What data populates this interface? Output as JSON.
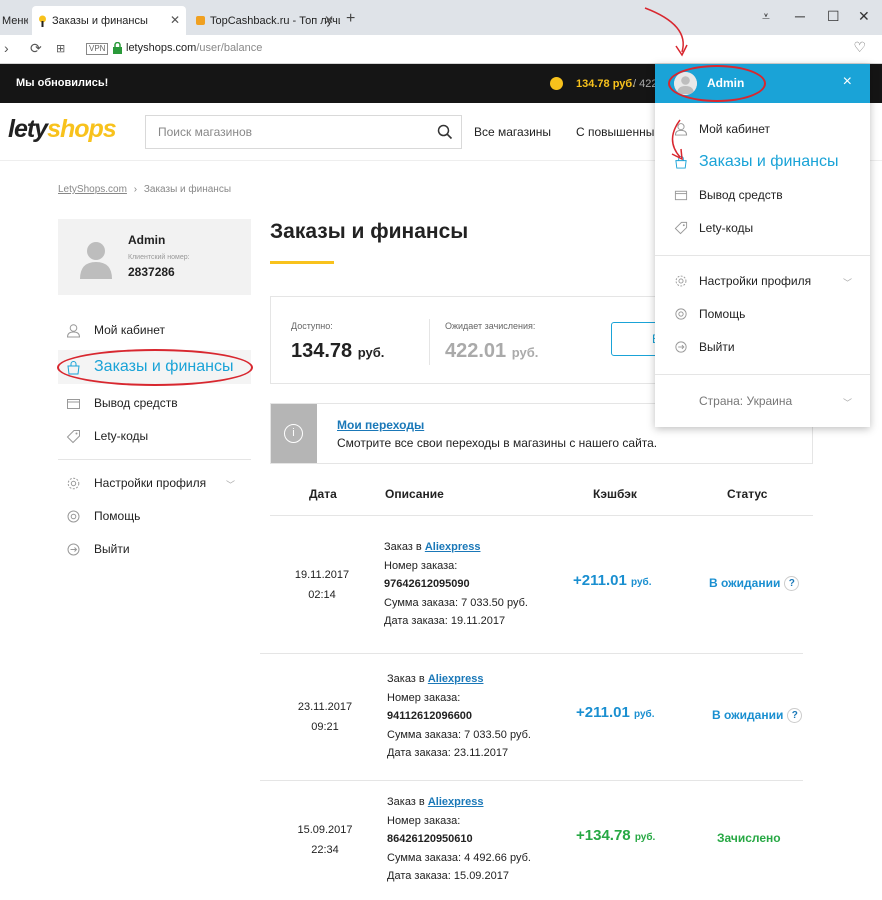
{
  "browser": {
    "tabs": [
      {
        "title": "Меню"
      },
      {
        "title": "Заказы и финансы"
      },
      {
        "title": "TopCashback.ru - Топ лучш"
      }
    ],
    "new_tab": "+",
    "url_host": "letyshops.com",
    "url_path": "/user/balance",
    "vpn_label": "VPN"
  },
  "topbar": {
    "notice": "Мы обновились!",
    "balance": "134.78 руб.",
    "pending": "/ 422"
  },
  "header": {
    "logo_lety": "lety",
    "logo_shops": "shops",
    "search_placeholder": "Поиск магазинов",
    "nav": [
      "Все магазины",
      "С повышенны"
    ]
  },
  "breadcrumb": {
    "home": "LetyShops.com",
    "separator": "›",
    "current": "Заказы и финансы"
  },
  "profile": {
    "name": "Admin",
    "client_label": "Клиентский номер:",
    "client_number": "2837286"
  },
  "sidebar": {
    "items": [
      {
        "label": "Мой кабинет",
        "icon": "user-icon"
      },
      {
        "label": "Заказы и финансы",
        "icon": "bag-icon"
      },
      {
        "label": "Вывод средств",
        "icon": "wallet-icon"
      },
      {
        "label": "Lety-коды",
        "icon": "tag-icon"
      },
      {
        "label": "Настройки профиля",
        "icon": "gear-icon"
      },
      {
        "label": "Помощь",
        "icon": "lifebuoy-icon"
      },
      {
        "label": "Выйти",
        "icon": "logout-icon"
      }
    ]
  },
  "main": {
    "title": "Заказы и финансы",
    "available_label": "Доступно:",
    "available_value": "134.78",
    "available_cur": "руб.",
    "pending_label": "Ожидает зачисления:",
    "pending_value": "422.01",
    "pending_cur": "руб.",
    "button_label": "В",
    "info_title": "Мои переходы",
    "info_text": "Смотрите все свои переходы в магазины с нашего сайта.",
    "columns": [
      "Дата",
      "Описание",
      "Кэшбэк",
      "Статус"
    ]
  },
  "orders": [
    {
      "date": "19.11.2017",
      "time": "02:14",
      "desc_prefix": "Заказ в",
      "shop": "Aliexpress",
      "order_label": "Номер заказа:",
      "order_number": "97642612095090",
      "sum": "Сумма заказа: 7 033.50 руб.",
      "order_date": "Дата заказа: 19.11.2017",
      "cashback": "+211.01",
      "cur": "руб.",
      "status": "В ожидании",
      "status_type": "pending"
    },
    {
      "date": "23.11.2017",
      "time": "09:21",
      "desc_prefix": "Заказ в",
      "shop": "Aliexpress",
      "order_label": "Номер заказа:",
      "order_number": "94112612096600",
      "sum": "Сумма заказа: 7 033.50 руб.",
      "order_date": "Дата заказа: 23.11.2017",
      "cashback": "+211.01",
      "cur": "руб.",
      "status": "В ожидании",
      "status_type": "pending"
    },
    {
      "date": "15.09.2017",
      "time": "22:34",
      "desc_prefix": "Заказ в",
      "shop": "Aliexpress",
      "order_label": "Номер заказа:",
      "order_number": "86426120950610",
      "sum": "Сумма заказа: 4 492.66 руб.",
      "order_date": "Дата заказа: 15.09.2017",
      "cashback": "+134.78",
      "cur": "руб.",
      "status": "Зачислено",
      "status_type": "done"
    }
  ],
  "dropdown": {
    "name": "Admin",
    "close": "×",
    "items": [
      {
        "label": "Мой кабинет",
        "icon": "user-icon"
      },
      {
        "label": "Заказы и финансы",
        "icon": "bag-icon"
      },
      {
        "label": "Вывод средств",
        "icon": "wallet-icon"
      },
      {
        "label": "Lety-коды",
        "icon": "tag-icon"
      },
      {
        "label": "Настройки профиля",
        "icon": "gear-icon"
      },
      {
        "label": "Помощь",
        "icon": "lifebuoy-icon"
      },
      {
        "label": "Выйти",
        "icon": "logout-icon"
      }
    ],
    "country": "Страна: Украина"
  },
  "colors": {
    "accent": "#1aa3d7",
    "brand_yellow": "#f8c21c",
    "annotation_red": "#d8272f",
    "success": "#27a844"
  }
}
